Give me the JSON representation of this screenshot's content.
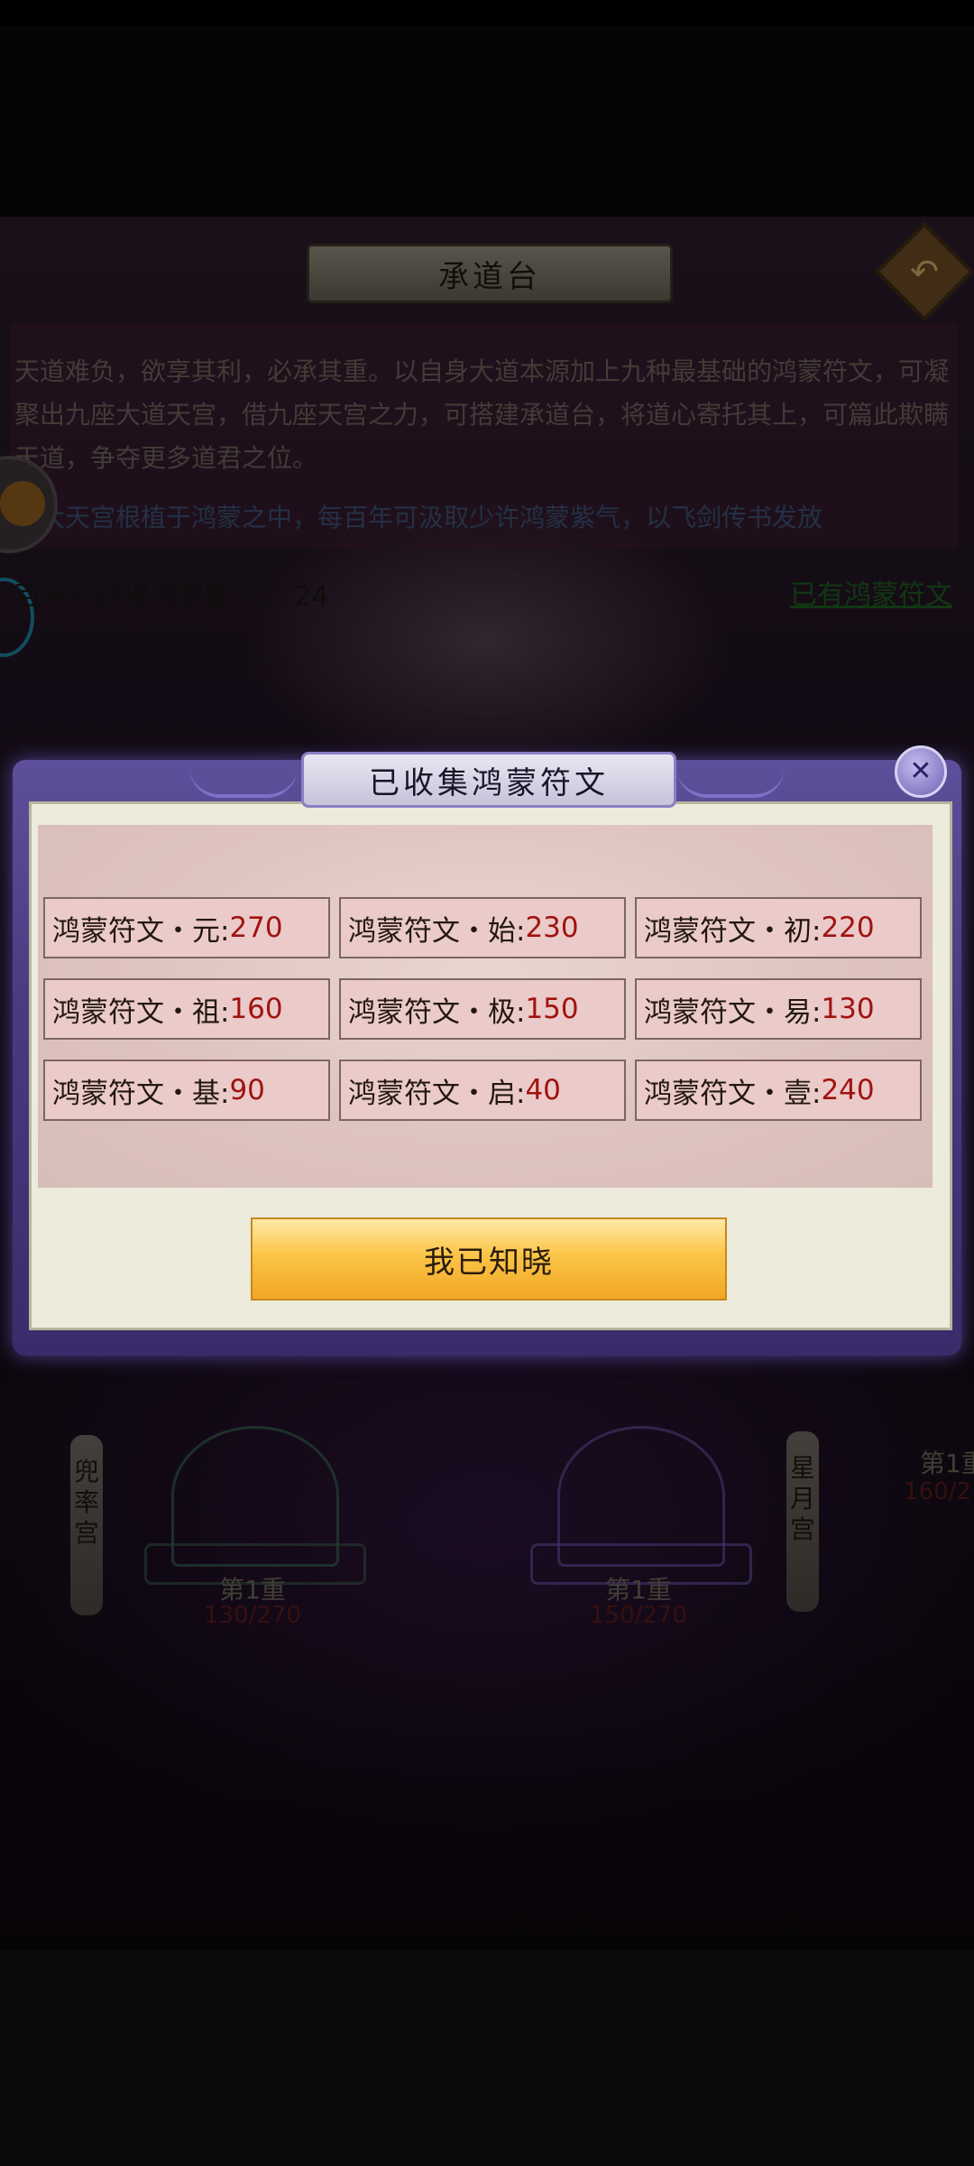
{
  "header": {
    "title": "承道台"
  },
  "description": {
    "text": "天道难负，欲享其利，必承其重。以自身大道本源加上九种最基础的鸿蒙符文，可凝聚出九座大道天宫，借九座天宫之力，可搭建承道台，将道心寄托其上，可篇此欺瞒天道，争夺更多道君之位。",
    "highlight": "九大天宫根植于鸿蒙之中，每百年可汲取少许鸿蒙紫气，以飞剑传书发放"
  },
  "gain": {
    "label": "百年可获得鸿蒙紫气：",
    "value": "24"
  },
  "owned_link": "已有鸿蒙符文",
  "palaces": [
    {
      "name": "兜率宫",
      "level": "第1重",
      "progress": "130/270"
    },
    {
      "name": "星月宫",
      "level": "第1重",
      "progress": "150/270"
    },
    {
      "name": "",
      "level": "第1重",
      "progress": "160/2"
    }
  ],
  "modal": {
    "title": "已收集鸿蒙符文",
    "runes": [
      {
        "label": "鸿蒙符文・元:",
        "value": "270"
      },
      {
        "label": "鸿蒙符文・始:",
        "value": "230"
      },
      {
        "label": "鸿蒙符文・初:",
        "value": "220"
      },
      {
        "label": "鸿蒙符文・祖:",
        "value": "160"
      },
      {
        "label": "鸿蒙符文・极:",
        "value": "150"
      },
      {
        "label": "鸿蒙符文・易:",
        "value": "130"
      },
      {
        "label": "鸿蒙符文・基:",
        "value": "90"
      },
      {
        "label": "鸿蒙符文・启:",
        "value": "40"
      },
      {
        "label": "鸿蒙符文・壹:",
        "value": "240"
      }
    ],
    "confirm_label": "我已知晓"
  },
  "icons": {
    "back": "back-arrow-icon",
    "close": "close-x-icon"
  },
  "colors": {
    "rune_value": "#a0130f",
    "button": "#fbc547",
    "modal_frame": "#4a3b82"
  }
}
